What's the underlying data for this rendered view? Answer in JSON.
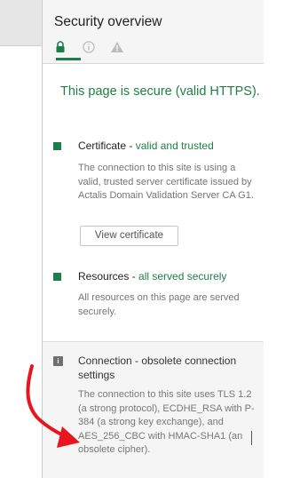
{
  "panel": {
    "title": "Security overview",
    "tabs": [
      {
        "name": "lock",
        "active": true
      },
      {
        "name": "info",
        "active": false
      },
      {
        "name": "warning",
        "active": false
      }
    ]
  },
  "secure_message": "This page is secure (valid HTTPS).",
  "certificate": {
    "label": "Certificate",
    "separator": " - ",
    "status": "valid and trusted",
    "description": "The connection to this site is using a valid, trusted server certificate issued by Actalis Domain Validation Server CA G1.",
    "button_label": "View certificate"
  },
  "resources": {
    "label": "Resources",
    "separator": " - ",
    "status": "all served securely",
    "description": "All resources on this page are served securely."
  },
  "connection": {
    "title": "Connection - obsolete connection settings",
    "info_glyph": "i",
    "description": "The connection to this site uses TLS 1.2 (a strong protocol), ECDHE_RSA with P-384 (a strong key exchange), and AES_256_CBC with HMAC-SHA1 (an obsolete cipher)."
  },
  "colors": {
    "secure_green": "#1e7f45",
    "status_square": "#1a7f4b",
    "annotation_arrow": "#e8141e",
    "header_bg": "#f5f5f5"
  },
  "icons": [
    "lock-icon",
    "info-circle-icon",
    "warning-triangle-icon",
    "info-icon"
  ]
}
